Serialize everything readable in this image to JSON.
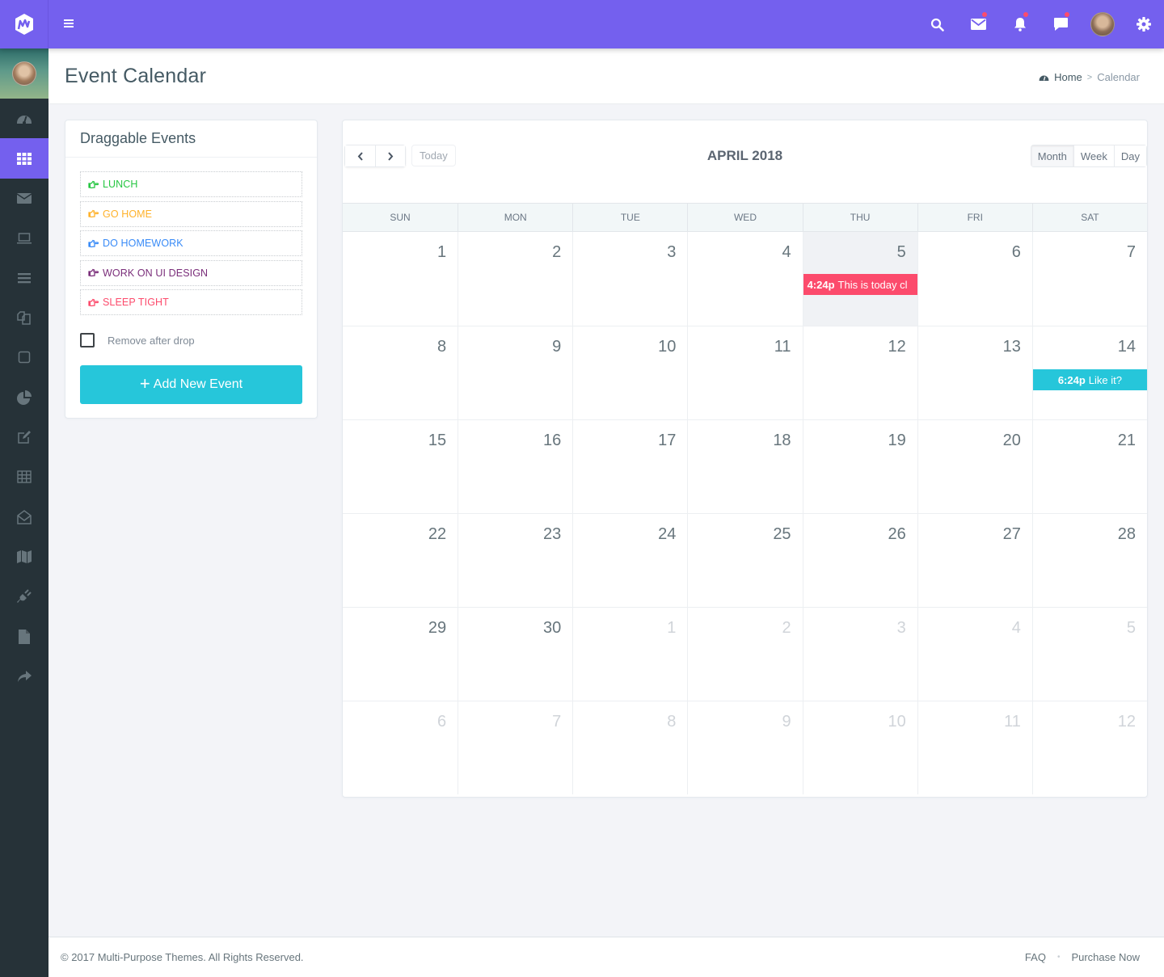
{
  "topbar": {
    "brand_color": "#7460ee",
    "icons": [
      {
        "name": "search-icon",
        "badge": false
      },
      {
        "name": "mail-icon",
        "badge": true
      },
      {
        "name": "bell-icon",
        "badge": true
      },
      {
        "name": "chat-icon",
        "badge": true
      },
      {
        "name": "user-avatar",
        "badge": false
      },
      {
        "name": "gear-icon",
        "badge": false
      }
    ]
  },
  "sidebar": {
    "items": [
      {
        "icon": "dashboard-icon",
        "active": false
      },
      {
        "icon": "apps-grid-icon",
        "active": true
      },
      {
        "icon": "mail-icon",
        "active": false
      },
      {
        "icon": "laptop-icon",
        "active": false
      },
      {
        "icon": "list-icon",
        "active": false
      },
      {
        "icon": "copy-icon",
        "active": false
      },
      {
        "icon": "square-icon",
        "active": false
      },
      {
        "icon": "pie-chart-icon",
        "active": false
      },
      {
        "icon": "edit-icon",
        "active": false
      },
      {
        "icon": "table-icon",
        "active": false
      },
      {
        "icon": "envelope-open-icon",
        "active": false
      },
      {
        "icon": "map-icon",
        "active": false
      },
      {
        "icon": "plug-icon",
        "active": false
      },
      {
        "icon": "file-icon",
        "active": false
      },
      {
        "icon": "share-icon",
        "active": false
      }
    ]
  },
  "header": {
    "title": "Event Calendar",
    "breadcrumb": {
      "home": "Home",
      "separator": ">",
      "current": "Calendar"
    }
  },
  "draggable": {
    "title": "Draggable Events",
    "events": [
      {
        "label": "LUNCH",
        "color": "#26c642"
      },
      {
        "label": "GO HOME",
        "color": "#ffb22b"
      },
      {
        "label": "DO HOMEWORK",
        "color": "#398bf7"
      },
      {
        "label": "WORK ON UI DESIGN",
        "color": "#7a2e7a"
      },
      {
        "label": "SLEEP TIGHT",
        "color": "#fc4b6c"
      }
    ],
    "remove_after_drop_label": "Remove after drop",
    "remove_after_drop_checked": false,
    "add_button_label": "Add New Event"
  },
  "calendar": {
    "title": "APRIL 2018",
    "today_label": "Today",
    "views": [
      {
        "label": "Month",
        "active": true
      },
      {
        "label": "Week",
        "active": false
      },
      {
        "label": "Day",
        "active": false
      }
    ],
    "weekdays": [
      "SUN",
      "MON",
      "TUE",
      "WED",
      "THU",
      "FRI",
      "SAT"
    ],
    "weeks": [
      [
        {
          "d": "1"
        },
        {
          "d": "2"
        },
        {
          "d": "3"
        },
        {
          "d": "4"
        },
        {
          "d": "5",
          "today": true
        },
        {
          "d": "6"
        },
        {
          "d": "7"
        }
      ],
      [
        {
          "d": "8"
        },
        {
          "d": "9"
        },
        {
          "d": "10"
        },
        {
          "d": "11"
        },
        {
          "d": "12"
        },
        {
          "d": "13"
        },
        {
          "d": "14"
        }
      ],
      [
        {
          "d": "15"
        },
        {
          "d": "16"
        },
        {
          "d": "17"
        },
        {
          "d": "18"
        },
        {
          "d": "19"
        },
        {
          "d": "20"
        },
        {
          "d": "21"
        }
      ],
      [
        {
          "d": "22"
        },
        {
          "d": "23"
        },
        {
          "d": "24"
        },
        {
          "d": "25"
        },
        {
          "d": "26"
        },
        {
          "d": "27"
        },
        {
          "d": "28"
        }
      ],
      [
        {
          "d": "29"
        },
        {
          "d": "30"
        },
        {
          "d": "1",
          "other": true
        },
        {
          "d": "2",
          "other": true
        },
        {
          "d": "3",
          "other": true
        },
        {
          "d": "4",
          "other": true
        },
        {
          "d": "5",
          "other": true
        }
      ],
      [
        {
          "d": "6",
          "other": true
        },
        {
          "d": "7",
          "other": true
        },
        {
          "d": "8",
          "other": true
        },
        {
          "d": "9",
          "other": true
        },
        {
          "d": "10",
          "other": true
        },
        {
          "d": "11",
          "other": true
        },
        {
          "d": "12",
          "other": true
        }
      ]
    ],
    "events": [
      {
        "week": 0,
        "day": 4,
        "time": "4:24p",
        "title": "This is today cl",
        "color": "#fc4b6c",
        "align": "left"
      },
      {
        "week": 1,
        "day": 6,
        "time": "6:24p",
        "title": "Like it?",
        "color": "#26c6da",
        "align": "center"
      }
    ]
  },
  "footer": {
    "copyright": "© 2017 Multi-Purpose Themes. All Rights Reserved.",
    "links": [
      "FAQ",
      "Purchase Now"
    ]
  }
}
